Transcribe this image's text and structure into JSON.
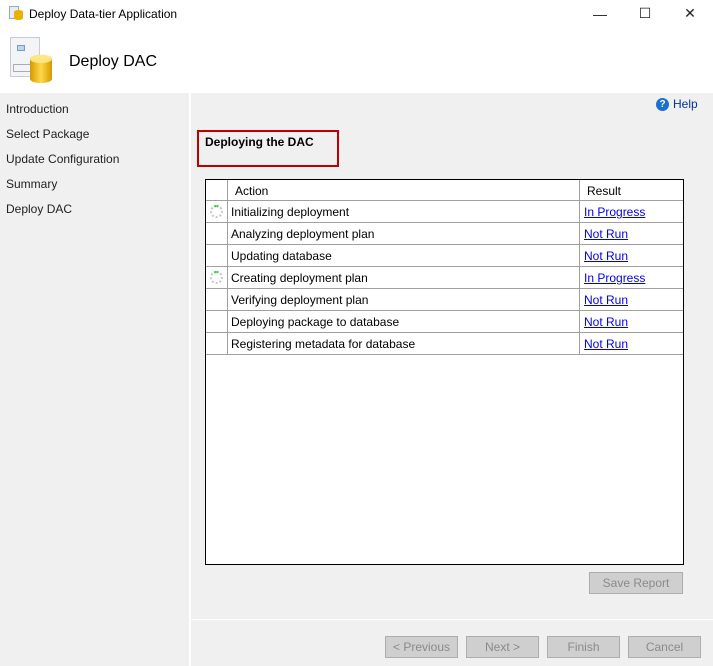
{
  "window": {
    "title": "Deploy Data-tier Application",
    "minimize": "—",
    "maximize": "☐",
    "close": "✕"
  },
  "header": {
    "title": "Deploy DAC"
  },
  "nav": {
    "items": [
      "Introduction",
      "Select Package",
      "Update Configuration",
      "Summary",
      "Deploy DAC"
    ]
  },
  "help": {
    "label": "Help",
    "icon": "?"
  },
  "main": {
    "heading": "Deploying the DAC"
  },
  "table": {
    "columns": [
      "Action",
      "Result"
    ],
    "rows": [
      {
        "action": "Initializing deployment",
        "result": "In Progress",
        "spinner": true
      },
      {
        "action": "Analyzing deployment plan",
        "result": "Not Run",
        "spinner": false
      },
      {
        "action": "Updating database",
        "result": "Not Run",
        "spinner": false
      },
      {
        "action": "Creating deployment plan",
        "result": "In Progress",
        "spinner": true
      },
      {
        "action": "Verifying deployment plan",
        "result": "Not Run",
        "spinner": false
      },
      {
        "action": "Deploying package to database",
        "result": "Not Run",
        "spinner": false
      },
      {
        "action": "Registering metadata for database",
        "result": "Not Run",
        "spinner": false
      }
    ]
  },
  "buttons": {
    "save_report": "Save Report",
    "previous": "< Previous",
    "next": "Next >",
    "finish": "Finish",
    "cancel": "Cancel"
  }
}
